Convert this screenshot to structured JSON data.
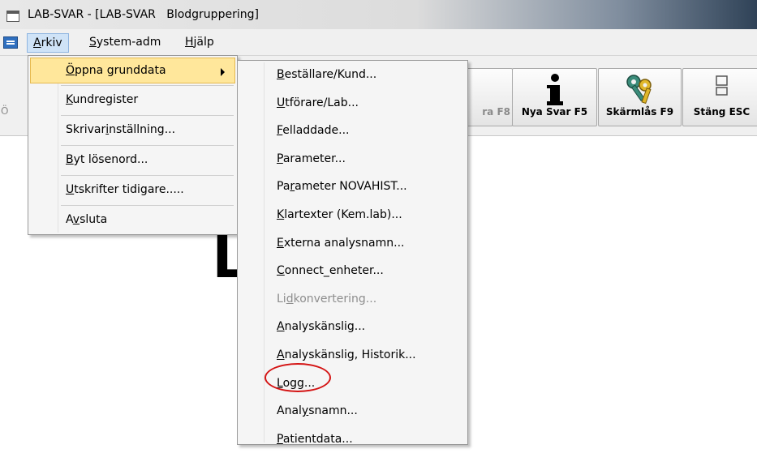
{
  "window": {
    "title": "LAB-SVAR - [LAB-SVAR   Blodgruppering]"
  },
  "menubar": {
    "items": [
      {
        "pre": "",
        "key": "A",
        "post": "rkiv"
      },
      {
        "pre": "",
        "key": "S",
        "post": "ystem-adm"
      },
      {
        "pre": "",
        "key": "H",
        "post": "jälp"
      }
    ]
  },
  "toolbar": {
    "left_partial": "Ö",
    "partial_label": "ra F8",
    "nya_svar": "Nya Svar F5",
    "skarmlas": "Skärmlås F9",
    "stang": "Stäng ESC"
  },
  "background": {
    "big_letter": "L"
  },
  "arkiv_menu": {
    "items": [
      {
        "pre": "",
        "key": "Ö",
        "post": "ppna grunddata"
      },
      {
        "pre": "",
        "key": "K",
        "post": "undregister"
      },
      {
        "pre": "Skrivar",
        "key": "i",
        "post": "nställning..."
      },
      {
        "pre": "",
        "key": "B",
        "post": "yt lösenord..."
      },
      {
        "pre": "",
        "key": "U",
        "post": "tskrifter tidigare....."
      },
      {
        "pre": "A",
        "key": "v",
        "post": "sluta"
      }
    ]
  },
  "grunddata_menu": {
    "items": [
      {
        "pre": "",
        "key": "B",
        "post": "eställare/Kund..."
      },
      {
        "pre": "",
        "key": "U",
        "post": "tförare/Lab..."
      },
      {
        "pre": "",
        "key": "F",
        "post": "elladdade..."
      },
      {
        "pre": "",
        "key": "P",
        "post": "arameter..."
      },
      {
        "pre": "Pa",
        "key": "r",
        "post": "ameter NOVAHIST..."
      },
      {
        "pre": "",
        "key": "K",
        "post": "lartexter (Kem.lab)..."
      },
      {
        "pre": "",
        "key": "E",
        "post": "xterna analysnamn..."
      },
      {
        "pre": "",
        "key": "C",
        "post": "onnect_enheter..."
      },
      {
        "pre": "Li",
        "key": "d",
        "post": "konvertering..."
      },
      {
        "pre": "",
        "key": "A",
        "post": "nalyskänslig..."
      },
      {
        "pre": "",
        "key": "A",
        "post": "nalyskänslig, Historik..."
      },
      {
        "pre": "",
        "key": "L",
        "post": "ogg..."
      },
      {
        "pre": "Anal",
        "key": "y",
        "post": "snamn..."
      },
      {
        "pre": "",
        "key": "P",
        "post": "atientdata..."
      }
    ]
  },
  "colors": {
    "highlight_fill": "#ffe79b",
    "annotation_circle": "#d41414",
    "disabled_text": "#8d8d8d"
  }
}
